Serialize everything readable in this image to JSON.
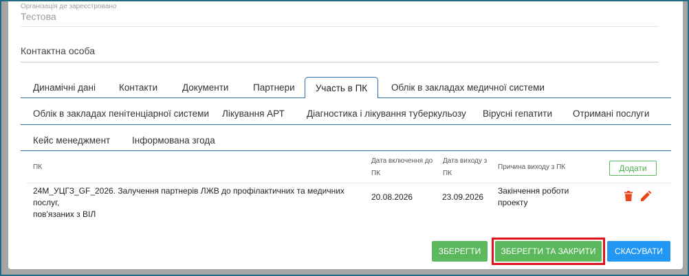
{
  "form": {
    "organization_label": "Організація де зареєстровано",
    "organization_value": "Тестова",
    "contact_label": "Контактна особа"
  },
  "tabs": {
    "row1": [
      "Динамічні дані",
      "Контакти",
      "Документи",
      "Партнери",
      "Участь в ПК",
      "Облік в закладах медичної системи"
    ],
    "row2": [
      "Облік в закладах пенітенціарної системи",
      "Лікування АРТ",
      "Діагностика і лікування туберкульозу",
      "Вірусні гепатити",
      "Отримані послуги"
    ],
    "row3": [
      "Кейс менеджмент",
      "Інформована згода"
    ],
    "active": "Участь в ПК"
  },
  "table": {
    "headers": {
      "pk": "ПК",
      "start_date_1": "Дата включення до",
      "start_date_2": "ПК",
      "end_date_1": "Дата виходу з",
      "end_date_2": "ПК",
      "reason": "Причина виходу з ПК"
    },
    "add_label": "Додати",
    "rows": [
      {
        "pk_line1": "24М_УЦГЗ_GF_2026. Залучення партнерів ЛЖВ до профілактичних та медичних послуг,",
        "pk_line2": "пов'язаних з ВІЛ",
        "start_date": "20.08.2026",
        "end_date": "23.09.2026",
        "reason_line1": "Закінчення роботи",
        "reason_line2": "проекту"
      }
    ]
  },
  "footer": {
    "save_label": "ЗБЕРЕГТИ",
    "save_close_label": "ЗБЕРЕГТИ ТА ЗАКРИТИ",
    "cancel_label": "СКАСУВАТИ"
  },
  "colors": {
    "green": "#5cb85c",
    "blue": "#2196f3",
    "tab_border": "#2a6fb0",
    "highlight": "#e0131b",
    "delete_icon": "#e8461c",
    "edit_icon": "#e8461c"
  },
  "icons": {
    "delete": "trash-icon",
    "edit": "pencil-icon"
  }
}
